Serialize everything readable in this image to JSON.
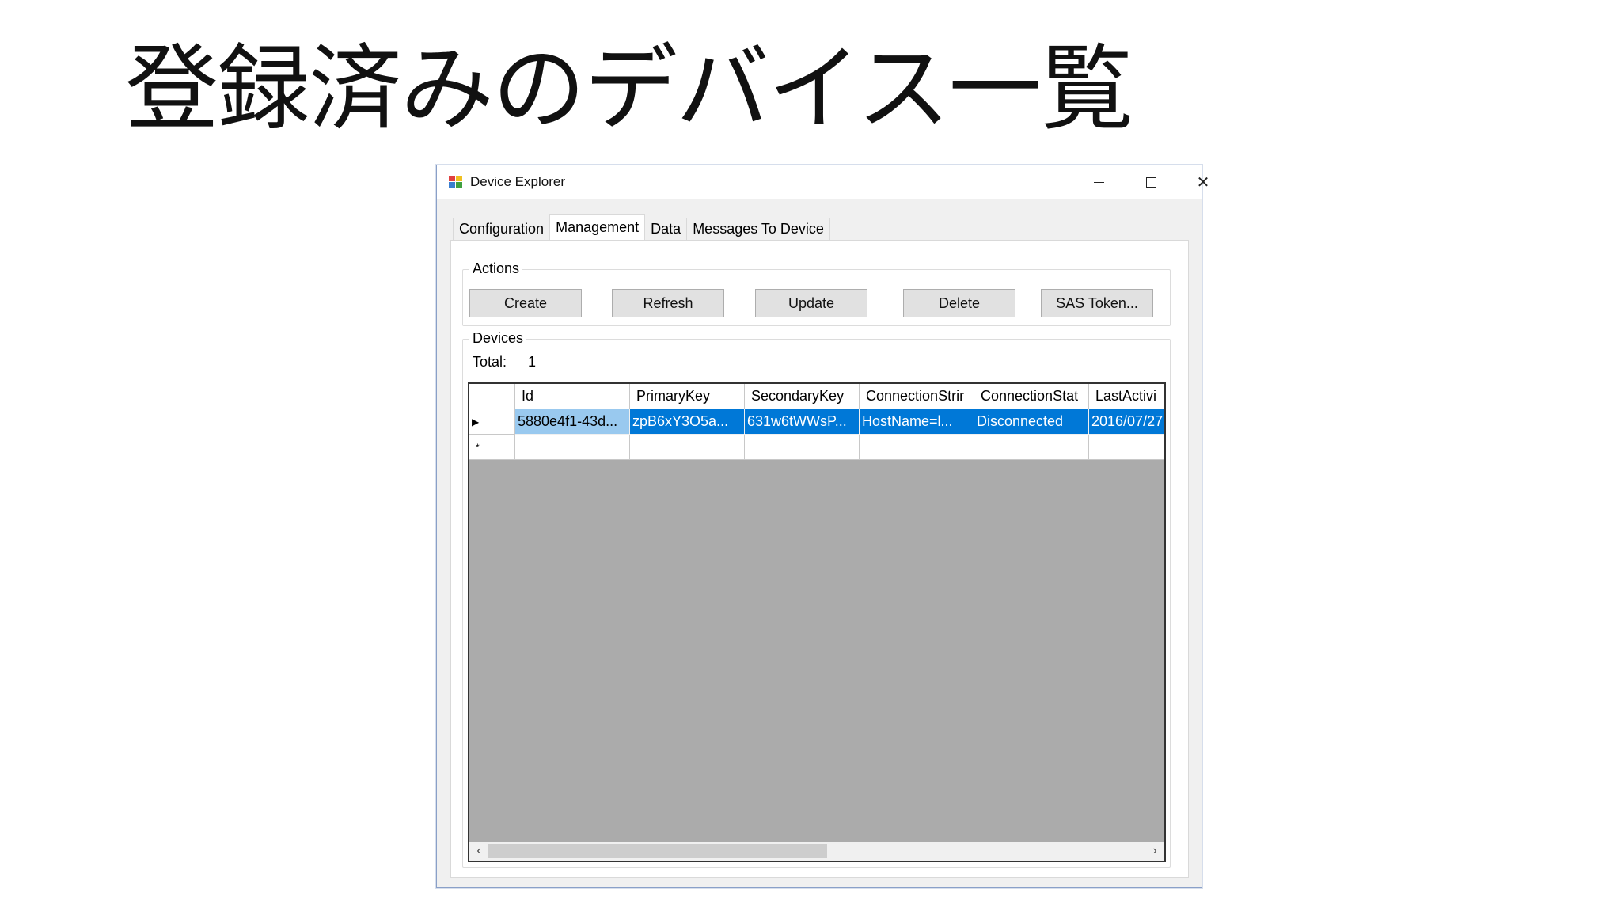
{
  "slide": {
    "title": "登録済みのデバイス一覧"
  },
  "window": {
    "title": "Device Explorer",
    "icons": {
      "app": "device-explorer-icon",
      "minimize": "minimize-icon",
      "maximize": "maximize-icon",
      "close": "close-icon"
    },
    "close_glyph": "✕"
  },
  "tabs": [
    {
      "label": "Configuration"
    },
    {
      "label": "Management",
      "active": true
    },
    {
      "label": "Data"
    },
    {
      "label": "Messages To Device"
    }
  ],
  "actions": {
    "group_label": "Actions",
    "buttons": [
      "Create",
      "Refresh",
      "Update",
      "Delete",
      "SAS Token..."
    ]
  },
  "devices": {
    "group_label": "Devices",
    "total_label": "Total:",
    "total_value": "1",
    "columns": [
      "Id",
      "PrimaryKey",
      "SecondaryKey",
      "ConnectionStrir",
      "ConnectionStat",
      "LastActivi"
    ],
    "rows": [
      {
        "selected": true,
        "row_marker": "▶",
        "cells": [
          "5880e4f1-43d...",
          "zpB6xY3O5a...",
          "631w6tWWsP...",
          "HostName=l...",
          "Disconnected",
          "2016/07/27"
        ]
      }
    ],
    "new_row_marker": "*",
    "scrollbar": {
      "left_arrow": "‹",
      "right_arrow": "›"
    }
  },
  "colors": {
    "selection": "#0078d7",
    "grid_background": "#ababab",
    "window_border": "#8aa0c8"
  }
}
